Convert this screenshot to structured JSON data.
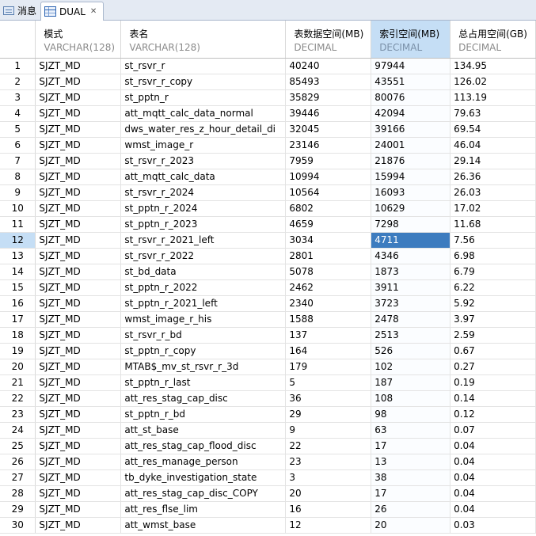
{
  "tabs": [
    {
      "label": "消息",
      "icon": "message-icon"
    },
    {
      "label": "DUAL",
      "icon": "grid-icon",
      "active": true
    }
  ],
  "columns": [
    {
      "name": "模式",
      "type": "VARCHAR(128)"
    },
    {
      "name": "表名",
      "type": "VARCHAR(128)"
    },
    {
      "name": "表数据空间(MB)",
      "type": "DECIMAL"
    },
    {
      "name": "索引空间(MB)",
      "type": "DECIMAL"
    },
    {
      "name": "总占用空间(GB)",
      "type": "DECIMAL"
    }
  ],
  "selected_row": 12,
  "selected_column": 3,
  "rows": [
    [
      "1",
      "SJZT_MD",
      "st_rsvr_r",
      "40240",
      "97944",
      "134.95"
    ],
    [
      "2",
      "SJZT_MD",
      "st_rsvr_r_copy",
      "85493",
      "43551",
      "126.02"
    ],
    [
      "3",
      "SJZT_MD",
      "st_pptn_r",
      "35829",
      "80076",
      "113.19"
    ],
    [
      "4",
      "SJZT_MD",
      "att_mqtt_calc_data_normal",
      "39446",
      "42094",
      "79.63"
    ],
    [
      "5",
      "SJZT_MD",
      "dws_water_res_z_hour_detail_di",
      "32045",
      "39166",
      "69.54"
    ],
    [
      "6",
      "SJZT_MD",
      "wmst_image_r",
      "23146",
      "24001",
      "46.04"
    ],
    [
      "7",
      "SJZT_MD",
      "st_rsvr_r_2023",
      "7959",
      "21876",
      "29.14"
    ],
    [
      "8",
      "SJZT_MD",
      "att_mqtt_calc_data",
      "10994",
      "15994",
      "26.36"
    ],
    [
      "9",
      "SJZT_MD",
      "st_rsvr_r_2024",
      "10564",
      "16093",
      "26.03"
    ],
    [
      "10",
      "SJZT_MD",
      "st_pptn_r_2024",
      "6802",
      "10629",
      "17.02"
    ],
    [
      "11",
      "SJZT_MD",
      "st_pptn_r_2023",
      "4659",
      "7298",
      "11.68"
    ],
    [
      "12",
      "SJZT_MD",
      "st_rsvr_r_2021_left",
      "3034",
      "4711",
      "7.56"
    ],
    [
      "13",
      "SJZT_MD",
      "st_rsvr_r_2022",
      "2801",
      "4346",
      "6.98"
    ],
    [
      "14",
      "SJZT_MD",
      "st_bd_data",
      "5078",
      "1873",
      "6.79"
    ],
    [
      "15",
      "SJZT_MD",
      "st_pptn_r_2022",
      "2462",
      "3911",
      "6.22"
    ],
    [
      "16",
      "SJZT_MD",
      "st_pptn_r_2021_left",
      "2340",
      "3723",
      "5.92"
    ],
    [
      "17",
      "SJZT_MD",
      "wmst_image_r_his",
      "1588",
      "2478",
      "3.97"
    ],
    [
      "18",
      "SJZT_MD",
      "st_rsvr_r_bd",
      "137",
      "2513",
      "2.59"
    ],
    [
      "19",
      "SJZT_MD",
      "st_pptn_r_copy",
      "164",
      "526",
      "0.67"
    ],
    [
      "20",
      "SJZT_MD",
      "MTAB$_mv_st_rsvr_r_3d",
      "179",
      "102",
      "0.27"
    ],
    [
      "21",
      "SJZT_MD",
      "st_pptn_r_last",
      "5",
      "187",
      "0.19"
    ],
    [
      "22",
      "SJZT_MD",
      "att_res_stag_cap_disc",
      "36",
      "108",
      "0.14"
    ],
    [
      "23",
      "SJZT_MD",
      "st_pptn_r_bd",
      "29",
      "98",
      "0.12"
    ],
    [
      "24",
      "SJZT_MD",
      "att_st_base",
      "9",
      "63",
      "0.07"
    ],
    [
      "25",
      "SJZT_MD",
      "att_res_stag_cap_flood_disc",
      "22",
      "17",
      "0.04"
    ],
    [
      "26",
      "SJZT_MD",
      "att_res_manage_person",
      "23",
      "13",
      "0.04"
    ],
    [
      "27",
      "SJZT_MD",
      "tb_dyke_investigation_state",
      "3",
      "38",
      "0.04"
    ],
    [
      "28",
      "SJZT_MD",
      "att_res_stag_cap_disc_COPY",
      "20",
      "17",
      "0.04"
    ],
    [
      "29",
      "SJZT_MD",
      "att_res_flse_lim",
      "16",
      "26",
      "0.04"
    ],
    [
      "30",
      "SJZT_MD",
      "att_wmst_base",
      "12",
      "20",
      "0.03"
    ]
  ]
}
